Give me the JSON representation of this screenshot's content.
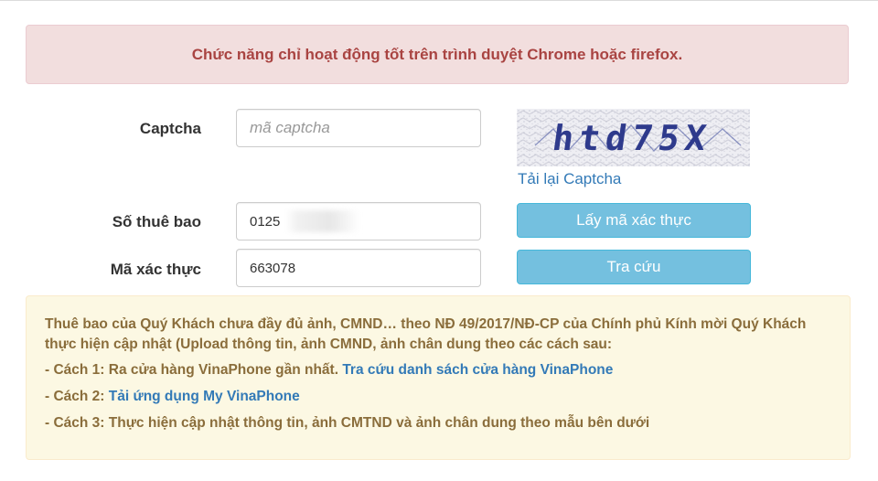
{
  "banner": {
    "text": "Chức năng chỉ hoạt động tốt trên trình duyệt Chrome hoặc firefox."
  },
  "form": {
    "captcha_label": "Captcha",
    "captcha_placeholder": "mã captcha",
    "captcha_image_text": "htd75X",
    "reload_captcha": "Tải lại Captcha",
    "subscriber_label": "Số thuê bao",
    "subscriber_value": "0125",
    "get_code_button": "Lấy mã xác thực",
    "verify_label": "Mã xác thực",
    "verify_value": "663078",
    "lookup_button": "Tra cứu"
  },
  "notice": {
    "intro": "Thuê bao của Quý Khách chưa đầy đủ ảnh, CMND… theo NĐ 49/2017/NĐ-CP của Chính phủ Kính mời Quý Khách thực hiện cập nhật (Upload thông tin, ảnh CMND, ảnh chân dung theo các cách sau:",
    "way1_text": "- Cách 1: Ra cửa hàng VinaPhone gần nhất. ",
    "way1_link": "Tra cứu danh sách cửa hàng VinaPhone",
    "way2_text": "- Cách 2: ",
    "way2_link": "Tải ứng dụng My VinaPhone",
    "way3_text": "- Cách 3: Thực hiện cập nhật thông tin, ảnh CMTND và ảnh chân dung theo mẫu bên dưới"
  },
  "colors": {
    "danger_bg": "#f2dede",
    "danger_text": "#a94442",
    "warning_bg": "#fcf8e3",
    "warning_text": "#8a6d3b",
    "link": "#337ab7",
    "button_bg": "#74c0df"
  }
}
